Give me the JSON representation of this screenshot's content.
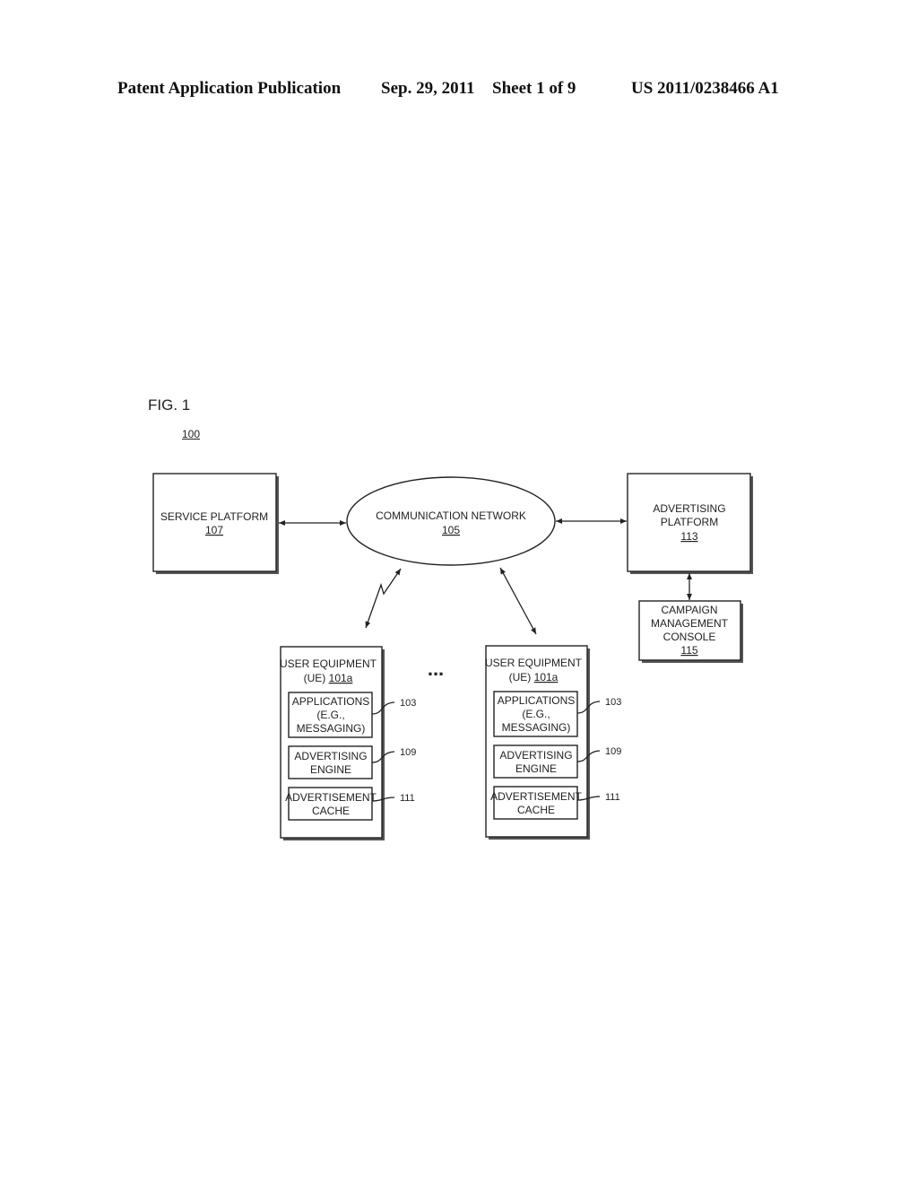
{
  "header": {
    "publication": "Patent Application Publication",
    "date": "Sep. 29, 2011",
    "sheet": "Sheet 1 of 9",
    "number": "US 2011/0238466 A1"
  },
  "figure": {
    "label": "FIG. 1",
    "ref": "100"
  },
  "nodes": {
    "service_platform": {
      "line1": "SERVICE PLATFORM",
      "ref": "107"
    },
    "communication_network": {
      "line1": "COMMUNICATION NETWORK",
      "ref": "105"
    },
    "advertising_platform": {
      "line1": "ADVERTISING",
      "line2": "PLATFORM",
      "ref": "113"
    },
    "campaign_console": {
      "line1": "CAMPAIGN",
      "line2": "MANAGEMENT",
      "line3": "CONSOLE",
      "ref": "115"
    },
    "ue_left": {
      "line1": "USER EQUIPMENT",
      "line2_prefix": "(UE) ",
      "ref": "101a",
      "applications": {
        "line1": "APPLICATIONS",
        "line2": "(E.G.,",
        "line3": "MESSAGING)",
        "ref": "103"
      },
      "engine": {
        "line1": "ADVERTISING",
        "line2": "ENGINE",
        "ref": "109"
      },
      "cache": {
        "line1": "ADVERTISEMENT",
        "line2": "CACHE",
        "ref": "111"
      }
    },
    "ue_right": {
      "line1": "USER EQUIPMENT",
      "line2_prefix": "(UE) ",
      "ref": "101a",
      "applications": {
        "line1": "APPLICATIONS",
        "line2": "(E.G.,",
        "line3": "MESSAGING)",
        "ref": "103"
      },
      "engine": {
        "line1": "ADVERTISING",
        "line2": "ENGINE",
        "ref": "109"
      },
      "cache": {
        "line1": "ADVERTISEMENT",
        "line2": "CACHE",
        "ref": "111"
      }
    },
    "ellipsis": "..."
  }
}
